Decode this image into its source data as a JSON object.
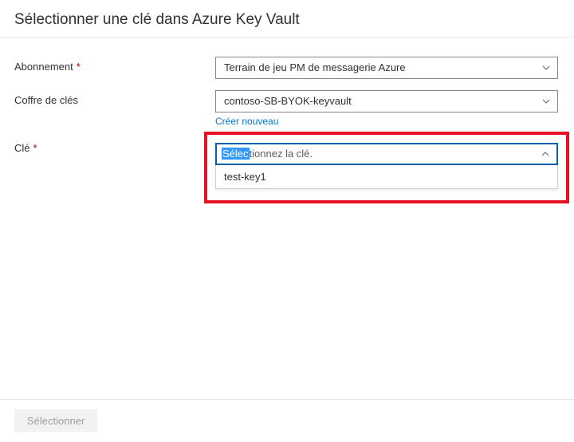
{
  "title": "Sélectionner une clé dans Azure Key Vault",
  "labels": {
    "subscription": "Abonnement",
    "keyvault": "Coffre de clés",
    "key": "Clé"
  },
  "subscription": {
    "value": "Terrain de jeu PM de messagerie Azure"
  },
  "keyvault": {
    "value": "contoso-SB-BYOK-keyvault",
    "create_new": "Créer nouveau"
  },
  "key": {
    "placeholder_highlight": "Sélec",
    "placeholder_rest": "tionnez la clé.",
    "options": [
      "test-key1"
    ]
  },
  "footer": {
    "select_button": "Sélectionner"
  }
}
